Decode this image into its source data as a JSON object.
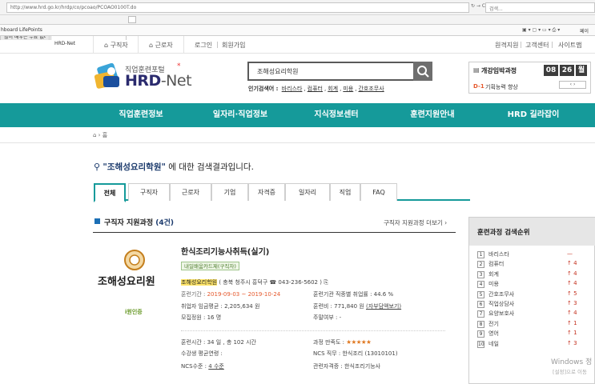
{
  "browser": {
    "url": "http://www.hrd.go.kr/hrdp/co/pcoao/PCOAO0100T.do",
    "refresh_label": "↻ → C",
    "search_placeholder": "검색...",
    "tabs": [
      "많이 배우는 무료 없다...",
      "HRD-Net"
    ],
    "favorites": [
      "hboard",
      "LifePoints"
    ],
    "toolbar_right": "페이"
  },
  "topbar": {
    "left": [
      "구직자",
      "근로자"
    ],
    "middle": [
      "로그인",
      "회원가입"
    ],
    "right": [
      "원격지원",
      "고객센터",
      "사이트맵"
    ]
  },
  "logo": {
    "sub": "직업훈련포털",
    "main_prefix": "HRD",
    "main_suffix": "-Net"
  },
  "search": {
    "value": "조해성요리학원",
    "popular_label": "인기검색어 :",
    "popular": [
      "바리스타",
      "컴퓨터",
      "회계",
      "미용",
      "간호조무사"
    ]
  },
  "calendar": {
    "title": "개강임박과정",
    "month": "08",
    "day": "26",
    "unit": "월",
    "dday": "D-1",
    "course": "기획능력 향상"
  },
  "nav": [
    "직업훈련정보",
    "일자리·직업정보",
    "지식정보센터",
    "훈련지원안내",
    "HRD 길라잡이"
  ],
  "breadcrumb": "홈",
  "results": {
    "query": "\"조해성요리학원\"",
    "suffix": " 에 대한 검색결과입니다.",
    "tabs": [
      "전체",
      "구직자",
      "근로자",
      "기업",
      "자격증",
      "일자리",
      "직업",
      "FAQ"
    ],
    "section_title": "구직자 지원과정",
    "section_count": "(4건)",
    "more": "구직자 지원과정 더보기 ›"
  },
  "course": {
    "org_logo_text": "조해성요리원",
    "cert_mark": "i원인증",
    "name": "한식조리기능사취득(실기)",
    "badge": "내일배움카드제(구직자)",
    "org": "조해성요리학원",
    "address": "( 충북 청주시 흥덕구 ☎ 043-236-5602 )",
    "period_label": "훈련기간 :",
    "period": "2019-09-03 ~ 2019-10-24",
    "employ_rate": "훈련기관 직종별 취업률 : 44.6 %",
    "wage": "취업자 임금평균 : 2,205,634 원",
    "fee_label": "훈련비 :",
    "fee": "771,840 원",
    "fee_link": "(자부담액보기)",
    "capacity": "모집정원 : 16 명",
    "weekend": "주말여부 : -",
    "hours": "훈련시간 : 34 일 , 총 102 시간",
    "satisfaction_label": "과정 만족도 :",
    "satisfaction": 4.5,
    "avg_age": "수강생 평균연령 :",
    "ncs_job": "NCS 직무 : 한식조리 (13010101)",
    "ncs_level_label": "NCS수준 :",
    "ncs_level": "4 수준",
    "related_cert": "관련자격증 : 한식조리기능사"
  },
  "ranking": {
    "title": "훈련과정 검색순위",
    "items": [
      {
        "rank": "1",
        "term": "바리스타",
        "change": "—"
      },
      {
        "rank": "2",
        "term": "컴퓨터",
        "change": "↑ 4"
      },
      {
        "rank": "3",
        "term": "회계",
        "change": "↑ 4"
      },
      {
        "rank": "4",
        "term": "미용",
        "change": "↑ 4"
      },
      {
        "rank": "5",
        "term": "간호조무사",
        "change": "↑ 5"
      },
      {
        "rank": "6",
        "term": "직업상담사",
        "change": "↑ 3"
      },
      {
        "rank": "7",
        "term": "요양보호사",
        "change": "↑ 4"
      },
      {
        "rank": "8",
        "term": "전기",
        "change": "↑ 1"
      },
      {
        "rank": "9",
        "term": "영어",
        "change": "↑ 1"
      },
      {
        "rank": "10",
        "term": "네일",
        "change": "↑ 3"
      }
    ]
  },
  "watermark": {
    "line1": "Windows 정",
    "line2": "[설정]으로 이동"
  }
}
